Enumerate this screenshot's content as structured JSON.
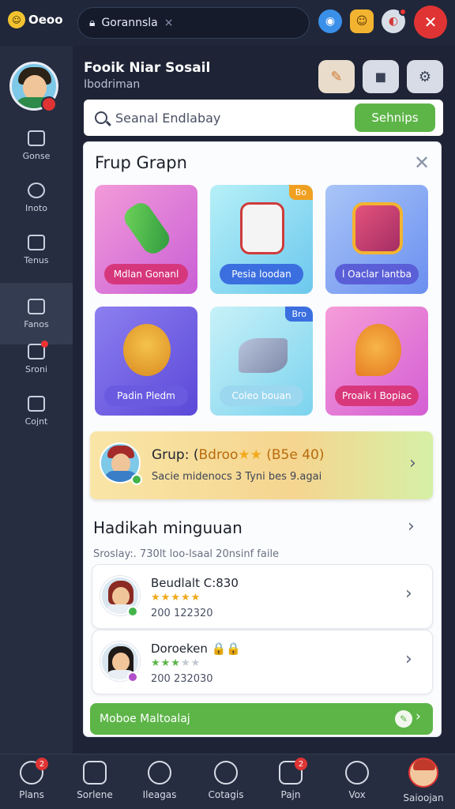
{
  "topbar": {
    "logo_label": "Oeoo",
    "url_text": "Gorannsla",
    "close_glyph": "×"
  },
  "sidebar": {
    "items": [
      {
        "label": "Gonse",
        "icon": "camera-icon"
      },
      {
        "label": "Inoto",
        "icon": "circle-icon"
      },
      {
        "label": "Tenus",
        "icon": "edit-icon"
      },
      {
        "label": "Fanos",
        "icon": "folder-icon"
      },
      {
        "label": "Sroni",
        "icon": "chat-icon"
      },
      {
        "label": "Cojnt",
        "icon": "lock-icon"
      }
    ]
  },
  "header": {
    "title": "Fooik Niar Sosail",
    "subtitle": "Ibodriman"
  },
  "search": {
    "placeholder": "Seanal Endlabay",
    "button_label": "Sehnips"
  },
  "modal": {
    "title": "Frup Grapn",
    "close_glyph": "✕",
    "tiles": [
      {
        "label": "Mdlan Gonanl",
        "tag": ""
      },
      {
        "label": "Pesia loodan",
        "tag": "Bo"
      },
      {
        "label": "l Oaclar lantba",
        "tag": ""
      },
      {
        "label": "Padin Pledm",
        "tag": ""
      },
      {
        "label": "Coleo bouan",
        "tag": "Bro"
      },
      {
        "label": "Proaik l Bopiac",
        "tag": ""
      }
    ],
    "group_card": {
      "title_prefix": "Grup: (",
      "title_accent": "Bdroo",
      "title_stars": "★★",
      "title_suffix": " (B5e 40)",
      "subtitle": "Sacie midenocs 3  Tyni bes 9.agai"
    },
    "weekly": {
      "title": "Hadikah minguuan",
      "subtitle": "Sroslay:. 730lt loo-lsaal 20nsinf faile"
    },
    "users": [
      {
        "name": "Beudlalt C:830",
        "stars_on": "★★★★★",
        "stars_off": "",
        "date": "200 122320"
      },
      {
        "name": "Doroeken 🔒🔒",
        "stars_on": "★★★",
        "stars_off": "★★",
        "date": "200 232030"
      }
    ],
    "action_label": "Moboe Maltoalaj"
  },
  "bottom_nav": {
    "items": [
      {
        "label": "Plans",
        "badge": "2"
      },
      {
        "label": "Sorlene",
        "badge": ""
      },
      {
        "label": "Ileagas",
        "badge": ""
      },
      {
        "label": "Cotagis",
        "badge": ""
      },
      {
        "label": "Pajn",
        "badge": "2"
      },
      {
        "label": "Vox",
        "badge": ""
      },
      {
        "label": "Saioojan",
        "badge": ""
      }
    ]
  },
  "colors": {
    "accent_green": "#5db548",
    "close_red": "#e03434",
    "sidebar_bg": "#262d40"
  }
}
